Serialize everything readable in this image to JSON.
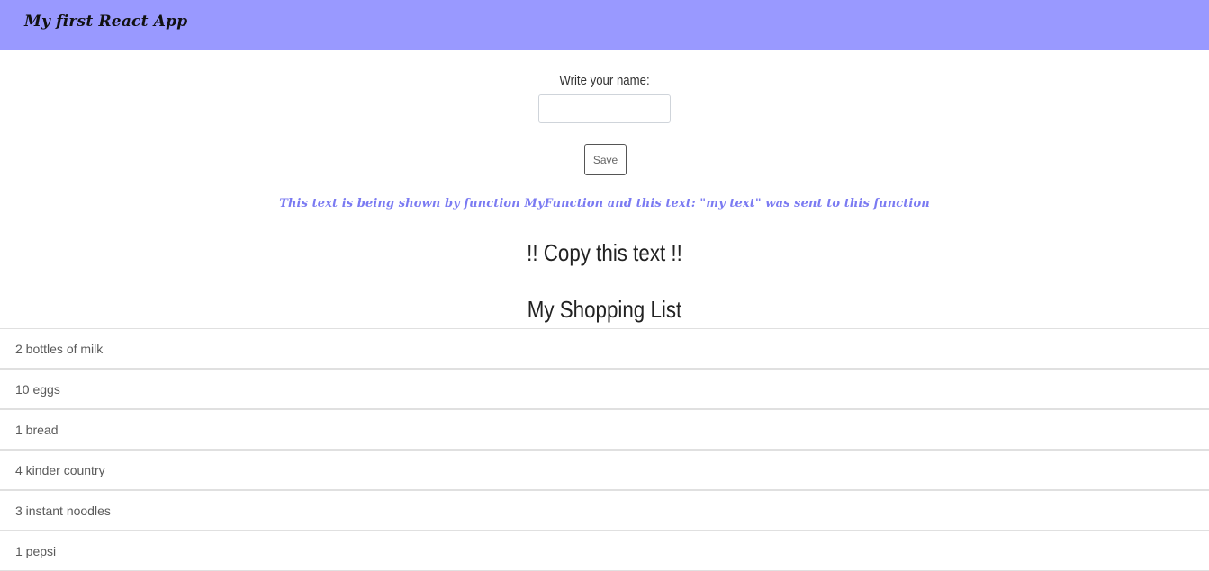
{
  "navbar": {
    "brand": "My first React App",
    "background": "#9999ff"
  },
  "form": {
    "name_label": "Write your name:",
    "name_value": "",
    "name_placeholder": "",
    "save_label": "Save"
  },
  "function_text": "This text is being shown by function MyFunction and this text: \"my text\" was sent to this function",
  "copy_heading": "!! Copy this text !!",
  "shopping": {
    "title": "My Shopping List",
    "items": [
      "2 bottles of milk",
      "10 eggs",
      "1 bread",
      "4 kinder country",
      "3 instant noodles",
      "1 pepsi"
    ]
  }
}
